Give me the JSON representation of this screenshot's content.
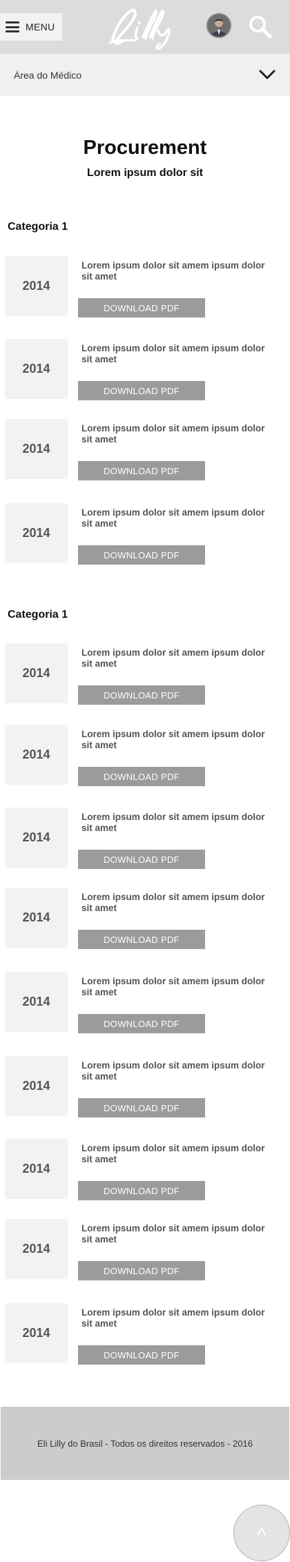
{
  "header": {
    "menu_label": "MENU",
    "logo_text": "Lilly"
  },
  "area": {
    "label": "Área do Médico"
  },
  "page": {
    "title": "Procurement",
    "subtitle": "Lorem ipsum dolor sit"
  },
  "categories": [
    {
      "title": "Categoria 1",
      "items": [
        {
          "year": "2014",
          "text": "Lorem ipsum dolor sit amem ipsum dolor sit amet",
          "button": "DOWNLOAD PDF"
        },
        {
          "year": "2014",
          "text": "Lorem ipsum dolor sit amem ipsum dolor sit amet",
          "button": "DOWNLOAD PDF"
        },
        {
          "year": "2014",
          "text": "Lorem ipsum dolor sit amem ipsum dolor sit amet",
          "button": "DOWNLOAD PDF"
        },
        {
          "year": "2014",
          "text": "Lorem ipsum dolor sit amem ipsum dolor sit amet",
          "button": "DOWNLOAD PDF"
        }
      ]
    },
    {
      "title": "Categoria 1",
      "items": [
        {
          "year": "2014",
          "text": "Lorem ipsum dolor sit amem ipsum dolor sit amet",
          "button": "DOWNLOAD PDF"
        },
        {
          "year": "2014",
          "text": "Lorem ipsum dolor sit amem ipsum dolor sit amet",
          "button": "DOWNLOAD PDF"
        },
        {
          "year": "2014",
          "text": "Lorem ipsum dolor sit amem ipsum dolor sit amet",
          "button": "DOWNLOAD PDF"
        },
        {
          "year": "2014",
          "text": "Lorem ipsum dolor sit amem ipsum dolor sit amet",
          "button": "DOWNLOAD PDF"
        },
        {
          "year": "2014",
          "text": "Lorem ipsum dolor sit amem ipsum dolor sit amet",
          "button": "DOWNLOAD PDF"
        },
        {
          "year": "2014",
          "text": "Lorem ipsum dolor sit amem ipsum dolor sit amet",
          "button": "DOWNLOAD PDF"
        },
        {
          "year": "2014",
          "text": "Lorem ipsum dolor sit amem ipsum dolor sit amet",
          "button": "DOWNLOAD PDF"
        },
        {
          "year": "2014",
          "text": "Lorem ipsum dolor sit amem ipsum dolor sit amet",
          "button": "DOWNLOAD PDF"
        },
        {
          "year": "2014",
          "text": "Lorem ipsum dolor sit amem ipsum dolor sit amet",
          "button": "DOWNLOAD PDF"
        }
      ]
    }
  ],
  "footer": {
    "text": "Eli Lilly do Brasil - Todos os direitos reservados - 2016"
  },
  "scroll_top": {
    "label": "^"
  },
  "colors": {
    "header_bg": "#dcdcdc",
    "button_bg": "#9b9b9b",
    "year_box_bg": "#f2f2f2",
    "footer_bg": "#cccccc"
  }
}
